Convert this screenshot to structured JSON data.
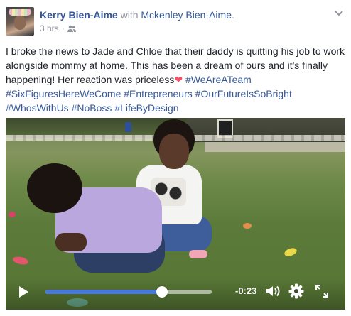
{
  "post": {
    "author": "Kerry Bien-Aime",
    "with_prefix": "with",
    "with_name": "Mckenley Bien-Aime",
    "with_suffix": ".",
    "time": "3 hrs",
    "time_separator": "·",
    "privacy_icon": "friends-icon",
    "menu_icon": "chevron-down-icon"
  },
  "text": {
    "main": "I broke the news to Jade and Chloe that their daddy is quitting his job to work alongside mommy at home. This has been a dream of ours and it's finally happening! Her reaction was priceless",
    "heart": "❤",
    "hashtags": [
      "#WeAreATeam",
      "#SixFiguresHereWeCome",
      "#Entrepreneurs",
      "#OurFutureIsSoBright",
      "#WhosWithUs",
      "#NoBoss",
      "#LifeByDesign"
    ]
  },
  "video": {
    "time_remaining": "-0:23",
    "progress": 0.7,
    "accent_color": "#4a78d6",
    "icons": [
      "play-icon",
      "volume-icon",
      "settings-gear-icon",
      "fullscreen-icon"
    ]
  }
}
